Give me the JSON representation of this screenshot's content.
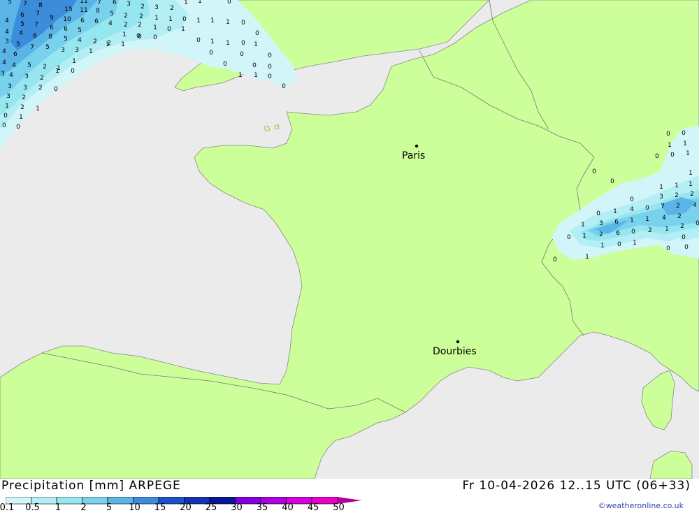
{
  "map": {
    "cities": [
      {
        "name": "Paris"
      },
      {
        "name": "Dourbies"
      }
    ],
    "precip_labels": {
      "atlantic": [
        "5",
        "7",
        "8",
        "11",
        "7",
        "6",
        "3",
        "2",
        "3",
        "2",
        "1",
        "1",
        "0",
        "4",
        "6",
        "7",
        "15",
        "11",
        "8",
        "5",
        "2",
        "2",
        "1",
        "4",
        "5",
        "9",
        "10",
        "6",
        "6",
        "4",
        "2",
        "2",
        "1",
        "1",
        "0",
        "3",
        "4",
        "7",
        "6",
        "6",
        "5",
        "1",
        "0",
        "0",
        "0",
        "1",
        "1",
        "1",
        "1",
        "0",
        "4",
        "5",
        "6",
        "8",
        "5",
        "4",
        "2",
        "2",
        "1",
        "0",
        "0",
        "1",
        "1",
        "0",
        "0",
        "4",
        "6",
        "7",
        "5",
        "3",
        "3",
        "1",
        "1",
        "0",
        "0",
        "1",
        "0",
        "3",
        "4",
        "5",
        "2",
        "1",
        "1",
        "0",
        "4",
        "3",
        "2",
        "1",
        "0",
        "0",
        "1",
        "0",
        "3",
        "3",
        "2",
        "0",
        "1",
        "0",
        "0",
        "3",
        "2",
        "1",
        "2",
        "1",
        "0",
        "1",
        "0",
        "0"
      ],
      "alps": [
        "0",
        "0",
        "1",
        "1",
        "0",
        "0",
        "1",
        "1",
        "1",
        "0",
        "0",
        "1",
        "1",
        "2",
        "0",
        "3",
        "2",
        "4",
        "0",
        "1",
        "4",
        "0",
        "7",
        "2",
        "2",
        "3",
        "6",
        "1",
        "1",
        "4",
        "2",
        "1",
        "1",
        "2",
        "6",
        "0",
        "2",
        "1",
        "0",
        "1",
        "0",
        "1",
        "0",
        "0",
        "0",
        "0",
        "1",
        "0"
      ]
    }
  },
  "footer": {
    "title_left": "Precipitation [mm] ARPEGE",
    "title_right": "Fr 10-04-2026 12..15 UTC (06+33)",
    "copyright": "©weatheronline.co.uk",
    "legend_labels": [
      "0.1",
      "0.5",
      "1",
      "2",
      "5",
      "10",
      "15",
      "20",
      "25",
      "30",
      "35",
      "40",
      "45",
      "50"
    ],
    "legend_colors": [
      "#d2f5fa",
      "#b4eef5",
      "#96e6f0",
      "#78d2ee",
      "#5ab4e6",
      "#3c8cdc",
      "#1e50c8",
      "#1432b4",
      "#0a1496",
      "#8200dc",
      "#aa00dc",
      "#d200dc",
      "#e600c8",
      "#b4009b"
    ]
  }
}
